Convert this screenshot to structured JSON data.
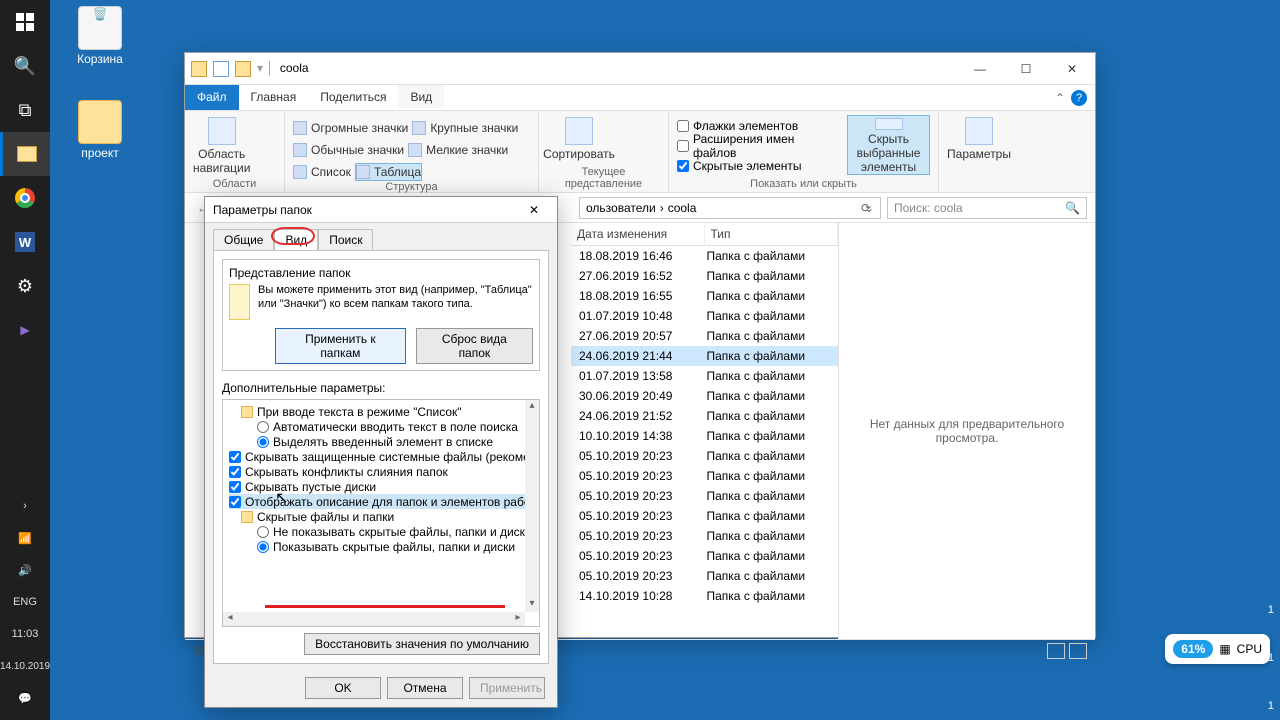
{
  "desktop": {
    "recycle": "Корзина",
    "project": "проект"
  },
  "taskbar": {
    "lang": "ENG",
    "time": "11:03",
    "date": "14.10.2019"
  },
  "explorer": {
    "title": "coola",
    "menu": {
      "file": "Файл",
      "home": "Главная",
      "share": "Поделиться",
      "view": "Вид"
    },
    "ribbon": {
      "navpane": "Область навигации",
      "grp_areas": "Области",
      "icons": {
        "vlg": "Огромные значки",
        "lg": "Крупные значки",
        "med": "Обычные значки",
        "sm": "Мелкие значки",
        "list": "Список",
        "details": "Таблица"
      },
      "grp_layout": "Структура",
      "sort": "Сортировать",
      "grp_view": "Текущее представление",
      "chk_flags": "Флажки элементов",
      "chk_ext": "Расширения имен файлов",
      "chk_hidden": "Скрытые элементы",
      "hide_sel": "Скрыть выбранные элементы",
      "options": "Параметры",
      "grp_show": "Показать или скрыть"
    },
    "breadcrumb": {
      "users": "ользователи",
      "folder": "coola"
    },
    "search_placeholder": "Поиск: coola",
    "columns": {
      "date": "Дата изменения",
      "type": "Тип"
    },
    "file_type": "Папка с файлами",
    "rows": [
      {
        "date": "18.08.2019 16:46"
      },
      {
        "date": "27.06.2019 16:52"
      },
      {
        "date": "18.08.2019 16:55"
      },
      {
        "date": "01.07.2019 10:48"
      },
      {
        "date": "27.06.2019 20:57"
      },
      {
        "date": "24.06.2019 21:44",
        "sel": true
      },
      {
        "date": "01.07.2019 13:58"
      },
      {
        "date": "30.06.2019 20:49"
      },
      {
        "date": "24.06.2019 21:52"
      },
      {
        "date": "10.10.2019 14:38"
      },
      {
        "date": "05.10.2019 20:23"
      },
      {
        "date": "05.10.2019 20:23"
      },
      {
        "date": "05.10.2019 20:23"
      },
      {
        "date": "05.10.2019 20:23"
      },
      {
        "date": "05.10.2019 20:23"
      },
      {
        "date": "05.10.2019 20:23"
      },
      {
        "date": "05.10.2019 20:23"
      },
      {
        "date": "14.10.2019 10:28"
      }
    ],
    "preview_empty": "Нет данных для предварительного просмотра.",
    "status_el": "Э"
  },
  "dialog": {
    "title": "Параметры папок",
    "tabs": {
      "general": "Общие",
      "view": "Вид",
      "search": "Поиск"
    },
    "folder_views": "Представление папок",
    "folder_desc": "Вы можете применить этот вид (например, \"Таблица\" или \"Значки\") ко всем папкам такого типа.",
    "apply_to": "Применить к папкам",
    "reset": "Сброс вида папок",
    "adv_label": "Дополнительные параметры:",
    "tree": {
      "typing": "При вводе текста в режиме \"Список\"",
      "typing_a": "Автоматически вводить текст в поле поиска",
      "typing_b": "Выделять введенный элемент в списке",
      "hide_prot": "Скрывать защищенные системные файлы (рекомен.",
      "hide_merge": "Скрывать конфликты слияния папок",
      "hide_empty": "Скрывать пустые диски",
      "show_tooltip": "Отображать описание для папок и элементов рабочего стола",
      "hidden_folder": "Скрытые файлы и папки",
      "hidden_a": "Не показывать скрытые файлы, папки и диски",
      "hidden_b": "Показывать скрытые файлы, папки и диски"
    },
    "restore_defaults": "Восстановить значения по умолчанию",
    "ok": "OK",
    "cancel": "Отмена",
    "apply": "Применить"
  },
  "cpu": {
    "pct": "61%",
    "label": "CPU"
  }
}
